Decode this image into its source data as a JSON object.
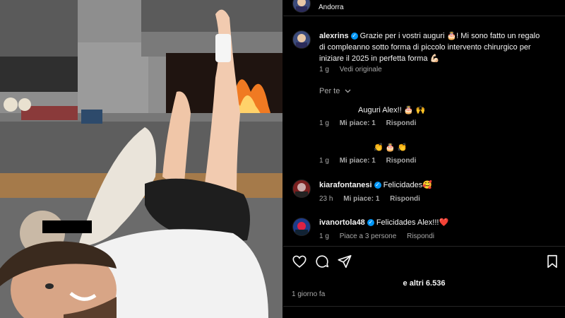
{
  "header": {
    "location": "Andorra"
  },
  "caption": {
    "username": "alexrins",
    "text_line1": "Grazie per i vostri auguri 🎂! Mi sono fatto un regalo",
    "text_line2": "di compleanno sotto forma di piccolo intervento chirurgico per",
    "text_line3": "iniziare il 2025 in perfetta forma 💪🏻",
    "time": "1 g",
    "see_original": "Vedi originale"
  },
  "for_you_label": "Per te",
  "comments": [
    {
      "text": "Auguri Alex!! 🎂 🙌",
      "time": "1 g",
      "likes": "Mi piace: 1",
      "reply": "Rispondi"
    },
    {
      "text": "👏 🎂 👏",
      "time": "1 g",
      "likes": "Mi piace: 1",
      "reply": "Rispondi"
    },
    {
      "username": "kiarafontanesi",
      "text": "Felicidades🥰",
      "time": "23 h",
      "likes": "Mi piace: 1",
      "reply": "Rispondi"
    },
    {
      "username": "ivanortola48",
      "text": "Felicidades Alex!!!❤️",
      "time": "1 g",
      "likes": "Piace a 3 persone",
      "reply": "Rispondi"
    }
  ],
  "footer": {
    "likes_text": "e altri 6.536",
    "date": "1 giorno fa"
  },
  "icons": [
    "heart-icon",
    "comment-icon",
    "share-icon",
    "bookmark-icon",
    "verified-icon",
    "chevron-down-icon"
  ],
  "colors": {
    "background": "#000000",
    "verified": "#0095f6",
    "muted_text": "#a8a8a8",
    "heart": "#ed4956"
  }
}
